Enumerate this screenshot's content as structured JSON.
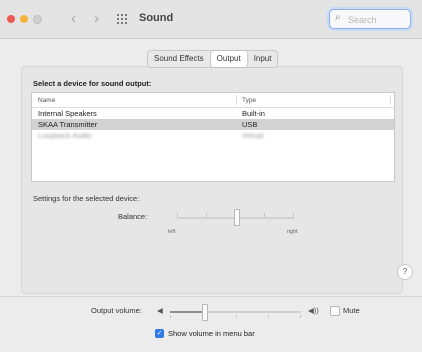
{
  "window": {
    "title": "Sound"
  },
  "toolbar": {
    "back_glyph": "‹",
    "forward_glyph": "›",
    "search_placeholder": "Search"
  },
  "tabs": [
    {
      "label": "Sound Effects",
      "active": false
    },
    {
      "label": "Output",
      "active": true
    },
    {
      "label": "Input",
      "active": false
    }
  ],
  "output": {
    "select_label": "Select a device for sound output:",
    "columns": [
      "Name",
      "Type"
    ],
    "devices": [
      {
        "name": "Internal Speakers",
        "type": "Built-in",
        "selected": false
      },
      {
        "name": "SKAA Transmitter",
        "type": "USB",
        "selected": true
      },
      {
        "name": "Loopback Audio",
        "type": "Virtual",
        "selected": false
      }
    ],
    "settings_label": "Settings for the selected device:",
    "balance_label": "Balance:",
    "balance_left": "left",
    "balance_right": "right",
    "balance_value": 0.5,
    "help_glyph": "?"
  },
  "volume": {
    "label": "Output volume:",
    "value": 0.26,
    "mute_label": "Mute",
    "mute_checked": false,
    "show_in_menu_label": "Show volume in menu bar",
    "show_in_menu_checked": true
  },
  "colors": {
    "close": "#ee5a52",
    "minimize": "#f2b53a",
    "accent": "#2f7ae5"
  }
}
